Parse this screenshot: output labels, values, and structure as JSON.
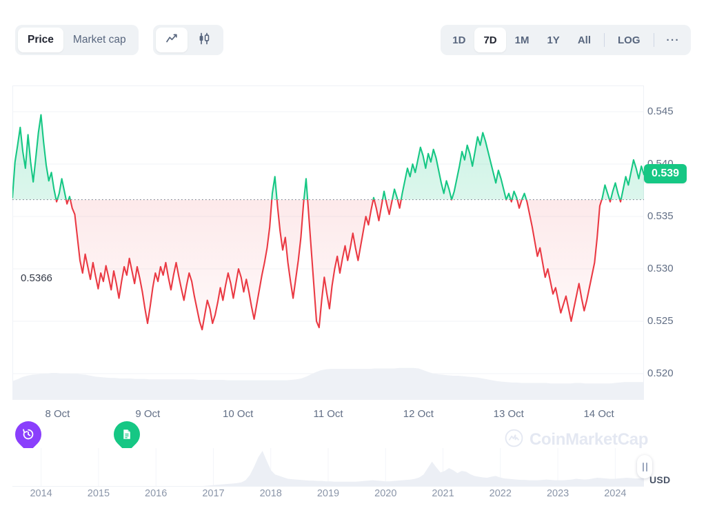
{
  "toolbar": {
    "metric_tabs": [
      {
        "label": "Price",
        "active": true
      },
      {
        "label": "Market cap",
        "active": false
      }
    ],
    "chart_type_buttons": [
      {
        "icon": "line-chart-icon",
        "active": true
      },
      {
        "icon": "candlestick-chart-icon",
        "active": false
      }
    ],
    "ranges": [
      {
        "label": "1D",
        "active": false
      },
      {
        "label": "7D",
        "active": true
      },
      {
        "label": "1M",
        "active": false
      },
      {
        "label": "1Y",
        "active": false
      },
      {
        "label": "All",
        "active": false
      }
    ],
    "log_label": "LOG",
    "more_label": "···"
  },
  "chart_data": {
    "type": "line",
    "title": "",
    "xlabel": "",
    "ylabel": "USD",
    "currency": "USD",
    "ylim": [
      0.5175,
      0.5475
    ],
    "y_ticks": [
      "0.545",
      "0.540",
      "0.535",
      "0.530",
      "0.525",
      "0.520"
    ],
    "y_tick_values": [
      0.545,
      0.54,
      0.535,
      0.53,
      0.525,
      0.52
    ],
    "x_ticks": [
      "8 Oct",
      "9 Oct",
      "10 Oct",
      "11 Oct",
      "12 Oct",
      "13 Oct",
      "14 Oct"
    ],
    "grid": true,
    "legend": false,
    "reference_line": {
      "label": "0.5366",
      "value": 0.5366
    },
    "current_price_badge": "0.539",
    "current_price_value": 0.539,
    "colors": {
      "up": "#16c784",
      "down": "#ea3943",
      "up_fill": "#16c784",
      "down_fill": "#ea3943"
    },
    "series": [
      {
        "name": "Price",
        "values": [
          0.5368,
          0.5402,
          0.5418,
          0.5435,
          0.5412,
          0.5396,
          0.5428,
          0.5402,
          0.5383,
          0.5406,
          0.543,
          0.5447,
          0.5421,
          0.5399,
          0.5384,
          0.5392,
          0.5376,
          0.5364,
          0.5372,
          0.5386,
          0.5374,
          0.5362,
          0.5369,
          0.5358,
          0.5352,
          0.533,
          0.5308,
          0.5296,
          0.5314,
          0.5302,
          0.529,
          0.5306,
          0.5293,
          0.5281,
          0.5296,
          0.5288,
          0.5303,
          0.5292,
          0.528,
          0.5298,
          0.5286,
          0.5272,
          0.5288,
          0.5302,
          0.5294,
          0.531,
          0.5298,
          0.5286,
          0.5302,
          0.5291,
          0.5278,
          0.5262,
          0.5248,
          0.5264,
          0.5282,
          0.5296,
          0.5288,
          0.5302,
          0.5294,
          0.5306,
          0.5292,
          0.528,
          0.5294,
          0.5306,
          0.5293,
          0.5281,
          0.527,
          0.5284,
          0.5296,
          0.5288,
          0.5274,
          0.5262,
          0.525,
          0.5242,
          0.5256,
          0.527,
          0.5262,
          0.5248,
          0.5256,
          0.5268,
          0.5282,
          0.527,
          0.5284,
          0.5296,
          0.5286,
          0.5272,
          0.5286,
          0.53,
          0.5292,
          0.5278,
          0.529,
          0.5278,
          0.5264,
          0.5252,
          0.5266,
          0.528,
          0.5294,
          0.5306,
          0.532,
          0.534,
          0.5372,
          0.5388,
          0.536,
          0.5336,
          0.5318,
          0.533,
          0.5306,
          0.5288,
          0.5272,
          0.529,
          0.5308,
          0.533,
          0.5362,
          0.5386,
          0.5352,
          0.5318,
          0.5284,
          0.525,
          0.5244,
          0.527,
          0.5292,
          0.5276,
          0.5262,
          0.5284,
          0.53,
          0.5312,
          0.5296,
          0.531,
          0.5322,
          0.5308,
          0.532,
          0.5334,
          0.532,
          0.5308,
          0.5322,
          0.5336,
          0.535,
          0.5342,
          0.5356,
          0.5368,
          0.5358,
          0.5346,
          0.536,
          0.5374,
          0.5362,
          0.5352,
          0.5364,
          0.5376,
          0.5368,
          0.5358,
          0.5372,
          0.5384,
          0.5396,
          0.5388,
          0.54,
          0.5392,
          0.5404,
          0.5416,
          0.5408,
          0.5396,
          0.541,
          0.5402,
          0.5414,
          0.5406,
          0.5394,
          0.5382,
          0.5372,
          0.5384,
          0.5376,
          0.5366,
          0.5374,
          0.5386,
          0.5398,
          0.5412,
          0.5404,
          0.5418,
          0.541,
          0.5398,
          0.5412,
          0.5426,
          0.5418,
          0.543,
          0.5422,
          0.5412,
          0.5402,
          0.5392,
          0.5382,
          0.5394,
          0.5386,
          0.5376,
          0.5366,
          0.5372,
          0.5364,
          0.5374,
          0.5368,
          0.5358,
          0.5366,
          0.5372,
          0.5364,
          0.5352,
          0.534,
          0.5326,
          0.5312,
          0.532,
          0.5306,
          0.5292,
          0.53,
          0.5288,
          0.5276,
          0.5282,
          0.527,
          0.5258,
          0.5266,
          0.5274,
          0.5262,
          0.525,
          0.5262,
          0.5274,
          0.5286,
          0.5272,
          0.526,
          0.527,
          0.5282,
          0.5294,
          0.5306,
          0.533,
          0.536,
          0.5368,
          0.538,
          0.5372,
          0.5364,
          0.5374,
          0.5382,
          0.5372,
          0.5364,
          0.5376,
          0.5388,
          0.538,
          0.5392,
          0.5404,
          0.5396,
          0.5386,
          0.5398,
          0.539
        ]
      }
    ],
    "volume_series": {
      "name": "Volume",
      "values": [
        0.38,
        0.42,
        0.47,
        0.5,
        0.52,
        0.53,
        0.54,
        0.55,
        0.56,
        0.56,
        0.55,
        0.55,
        0.54,
        0.54,
        0.53,
        0.52,
        0.5,
        0.48,
        0.47,
        0.46,
        0.45,
        0.45,
        0.44,
        0.44,
        0.44,
        0.43,
        0.43,
        0.43,
        0.42,
        0.42,
        0.42,
        0.42,
        0.42,
        0.42,
        0.42,
        0.42,
        0.42,
        0.42,
        0.41,
        0.41,
        0.41,
        0.41,
        0.41,
        0.41,
        0.4,
        0.4,
        0.4,
        0.4,
        0.4,
        0.4,
        0.4,
        0.4,
        0.4,
        0.4,
        0.4,
        0.4,
        0.4,
        0.41,
        0.42,
        0.44,
        0.48,
        0.53,
        0.58,
        0.62,
        0.64,
        0.65,
        0.65,
        0.65,
        0.65,
        0.65,
        0.65,
        0.65,
        0.65,
        0.65,
        0.66,
        0.66,
        0.66,
        0.66,
        0.66,
        0.67,
        0.67,
        0.67,
        0.67,
        0.66,
        0.62,
        0.58,
        0.55,
        0.53,
        0.52,
        0.51,
        0.5,
        0.5,
        0.49,
        0.48,
        0.47,
        0.46,
        0.44,
        0.42,
        0.4,
        0.38,
        0.37,
        0.36,
        0.35,
        0.35,
        0.34,
        0.34,
        0.34,
        0.34,
        0.34,
        0.34,
        0.33,
        0.33,
        0.33,
        0.33,
        0.33,
        0.34,
        0.34,
        0.33,
        0.33,
        0.33,
        0.33,
        0.33,
        0.33,
        0.34,
        0.35,
        0.36,
        0.36,
        0.36,
        0.36,
        0.36
      ]
    }
  },
  "markers": [
    {
      "name": "history-marker",
      "icon": "clock-history-icon",
      "color": "#8a3ffc",
      "x_pct": 4.0
    },
    {
      "name": "document-marker",
      "icon": "document-icon",
      "color": "#16c784",
      "x_pct": 18.0
    }
  ],
  "watermark": {
    "text": "CoinMarketCap",
    "icon": "coinmarketcap-logo-icon"
  },
  "minimap": {
    "years": [
      "2014",
      "2015",
      "2016",
      "2017",
      "2018",
      "2019",
      "2020",
      "2021",
      "2022",
      "2023",
      "2024"
    ],
    "history_values": [
      0.0,
      0.0,
      0.0,
      0.0,
      0.0,
      0.0,
      0.0,
      0.0,
      0.0,
      0.0,
      0.0,
      0.0,
      0.0,
      0.0,
      0.0,
      0.0,
      0.0,
      0.0,
      0.0,
      0.0,
      0.0,
      0.0,
      0.0,
      0.0,
      0.0,
      0.0,
      0.0,
      0.0,
      0.0,
      0.0,
      0.0,
      0.0,
      0.0,
      0.0,
      0.0,
      0.0,
      0.0,
      0.0,
      0.0,
      0.0,
      0.0,
      0.0,
      0.0,
      0.01,
      0.02,
      0.02,
      0.03,
      0.04,
      0.05,
      0.06,
      0.07,
      0.08,
      0.09,
      0.1,
      0.12,
      0.18,
      0.32,
      0.55,
      0.82,
      1.0,
      0.72,
      0.46,
      0.34,
      0.3,
      0.26,
      0.22,
      0.21,
      0.2,
      0.19,
      0.18,
      0.17,
      0.17,
      0.16,
      0.16,
      0.15,
      0.15,
      0.14,
      0.14,
      0.14,
      0.14,
      0.14,
      0.14,
      0.15,
      0.16,
      0.17,
      0.18,
      0.17,
      0.16,
      0.15,
      0.15,
      0.16,
      0.17,
      0.18,
      0.19,
      0.2,
      0.22,
      0.26,
      0.34,
      0.52,
      0.7,
      0.54,
      0.4,
      0.44,
      0.52,
      0.46,
      0.38,
      0.44,
      0.42,
      0.35,
      0.3,
      0.28,
      0.26,
      0.25,
      0.28,
      0.3,
      0.26,
      0.23,
      0.22,
      0.21,
      0.2,
      0.19,
      0.19,
      0.18,
      0.18,
      0.18,
      0.19,
      0.2,
      0.19,
      0.18,
      0.18,
      0.18,
      0.19,
      0.2,
      0.22,
      0.21,
      0.2,
      0.21,
      0.23,
      0.25,
      0.24,
      0.23,
      0.22,
      0.22,
      0.23,
      0.24,
      0.25,
      0.24,
      0.23,
      0.23,
      0.24
    ],
    "handle": "resize-handle"
  }
}
